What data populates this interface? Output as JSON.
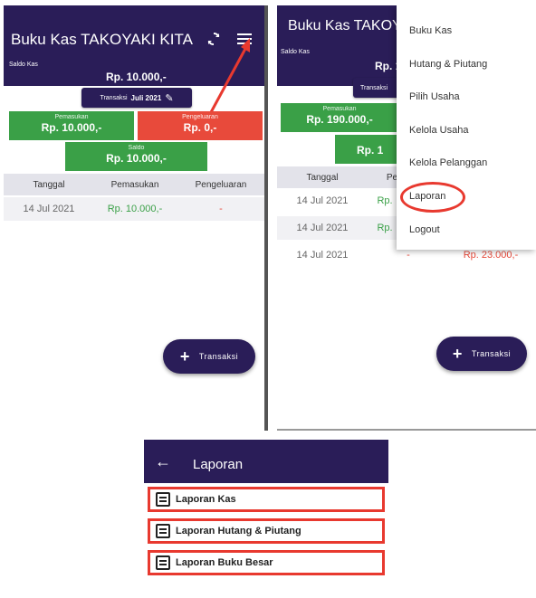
{
  "screen1": {
    "title": "Buku Kas TAKOYAKI KITA",
    "saldo_kas_label": "Saldo Kas",
    "saldo_kas_value": "Rp. 10.000,-",
    "transaksi_label": "Transaksi",
    "transaksi_period": "Juli 2021",
    "pemasukan_label": "Pemasukan",
    "pemasukan_value": "Rp. 10.000,-",
    "pengeluaran_label": "Pengeluaran",
    "pengeluaran_value": "Rp. 0,-",
    "saldo_label": "Saldo",
    "saldo_value": "Rp. 10.000,-",
    "table_headers": [
      "Tanggal",
      "Pemasukan",
      "Pengeluaran"
    ],
    "rows": [
      {
        "tanggal": "14 Jul 2021",
        "pemasukan": "Rp. 10.000,-",
        "pengeluaran": "-"
      }
    ],
    "fab_label": "Transaksi"
  },
  "screen2": {
    "title": "Buku Kas TAKOY",
    "saldo_kas_label": "Saldo Kas",
    "saldo_kas_partial": "Rp. 1",
    "transaksi_partial": "Transaksi",
    "pemasukan_label": "Pemasukan",
    "pemasukan_value": "Rp. 190.000,-",
    "saldo_partial": "Rp. 1",
    "table_headers": [
      "Tanggal",
      "Pe"
    ],
    "rows": [
      {
        "tanggal": "14 Jul 2021",
        "partial": "Rp."
      },
      {
        "tanggal": "14 Jul 2021",
        "partial": "Rp."
      },
      {
        "tanggal": "14 Jul 2021",
        "partial": "-",
        "pengeluaran": "Rp. 23.000,-"
      }
    ],
    "fab_label": "Transaksi",
    "menu_items": [
      "Buku Kas",
      "Hutang & Piutang",
      "Pilih Usaha",
      "Kelola Usaha",
      "Kelola Pelanggan",
      "Laporan",
      "Logout"
    ]
  },
  "screen3": {
    "title": "Laporan",
    "items": [
      "Laporan Kas",
      "Laporan Hutang & Piutang",
      "Laporan Buku Besar"
    ]
  },
  "colors": {
    "primary": "#2a1d58",
    "green": "#3aa047",
    "red": "#e84a3b",
    "highlight": "#e8392f"
  }
}
